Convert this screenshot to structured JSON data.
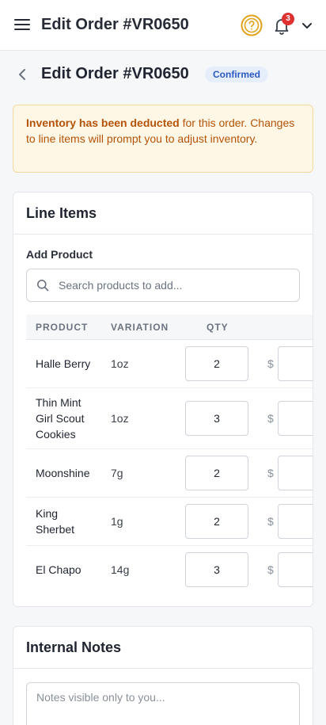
{
  "topbar": {
    "title": "Edit Order #VR0650",
    "menu_icon": "hamburger-menu-icon",
    "help_icon": "question-circle-icon",
    "bell_icon": "bell-icon",
    "notification_count": "3",
    "account_icon": "chevron-down-icon"
  },
  "page": {
    "title": "Edit Order #VR0650",
    "status": "Confirmed",
    "back_icon": "chevron-left-icon"
  },
  "alert": {
    "strong": "Inventory has been deducted",
    "text": " for this order. Changes to line items will prompt you to adjust inventory."
  },
  "line_items": {
    "title": "Line Items",
    "add_product_label": "Add Product",
    "search_placeholder": "Search products to add...",
    "columns": [
      "PRODUCT",
      "VARIATION",
      "QTY"
    ],
    "currency_symbol": "$",
    "rows": [
      {
        "product": "Halle Berry",
        "variation": "1oz",
        "qty": "2"
      },
      {
        "product": "Thin Mint Girl Scout Cookies",
        "variation": "1oz",
        "qty": "3"
      },
      {
        "product": "Moonshine",
        "variation": "7g",
        "qty": "2"
      },
      {
        "product": "King Sherbet",
        "variation": "1g",
        "qty": "2"
      },
      {
        "product": "El Chapo",
        "variation": "14g",
        "qty": "3"
      }
    ]
  },
  "notes": {
    "title": "Internal Notes",
    "placeholder": "Notes visible only to you..."
  },
  "colors": {
    "accent": "#2b59c3",
    "warning_bg": "#fff7e6",
    "warning_text": "#b45309",
    "help_icon": "#e0a21b",
    "badge": "#e03131"
  }
}
